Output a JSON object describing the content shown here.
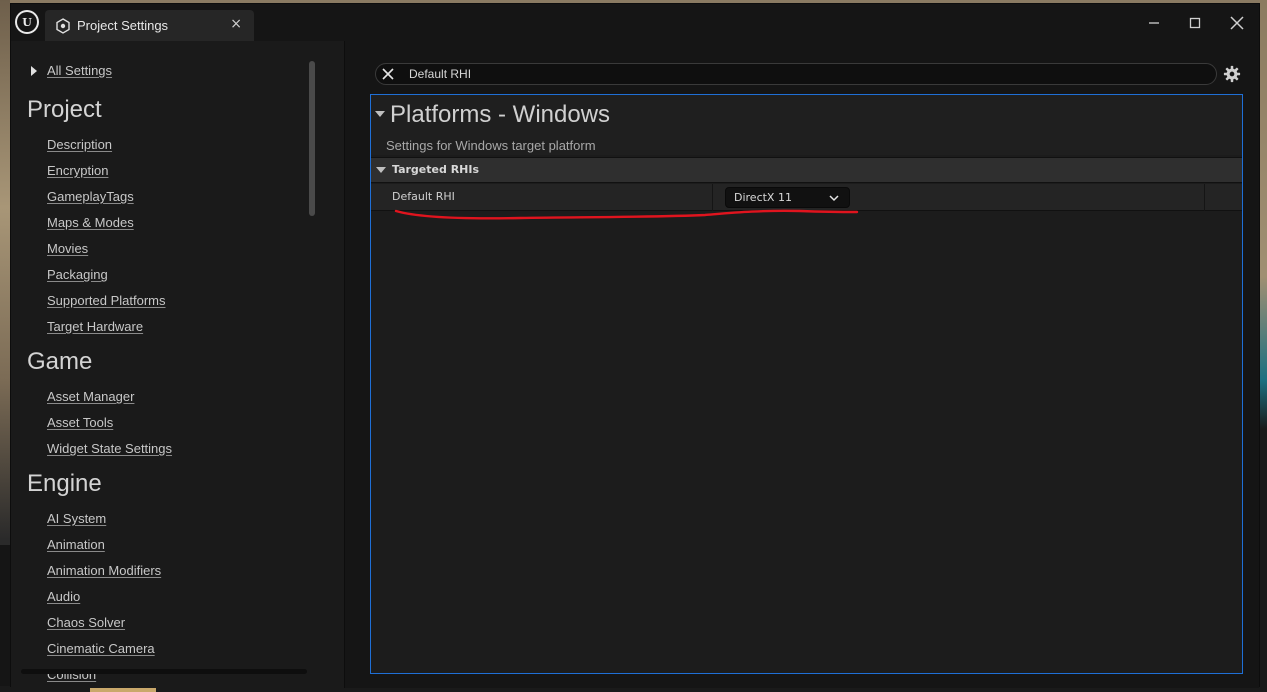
{
  "window": {
    "tab_title": "Project Settings",
    "tab_close": "×"
  },
  "sidebar": {
    "all_settings": "All Settings",
    "sections": [
      {
        "title": "Project",
        "items": [
          "Description",
          "Encryption",
          "GameplayTags",
          "Maps & Modes",
          "Movies",
          "Packaging",
          "Supported Platforms",
          "Target Hardware"
        ]
      },
      {
        "title": "Game",
        "items": [
          "Asset Manager",
          "Asset Tools",
          "Widget State Settings"
        ]
      },
      {
        "title": "Engine",
        "items": [
          "AI System",
          "Animation",
          "Animation Modifiers",
          "Audio",
          "Chaos Solver",
          "Cinematic Camera",
          "Collision"
        ]
      }
    ]
  },
  "search": {
    "value": "Default RHI"
  },
  "details": {
    "category_title": "Platforms - Windows",
    "category_description": "Settings for Windows target platform",
    "subcategory": "Targeted RHIs",
    "property_name": "Default RHI",
    "property_value": "DirectX 11"
  },
  "colors": {
    "accent_border": "#1f6fd6",
    "annotation_red": "#e0141e"
  }
}
